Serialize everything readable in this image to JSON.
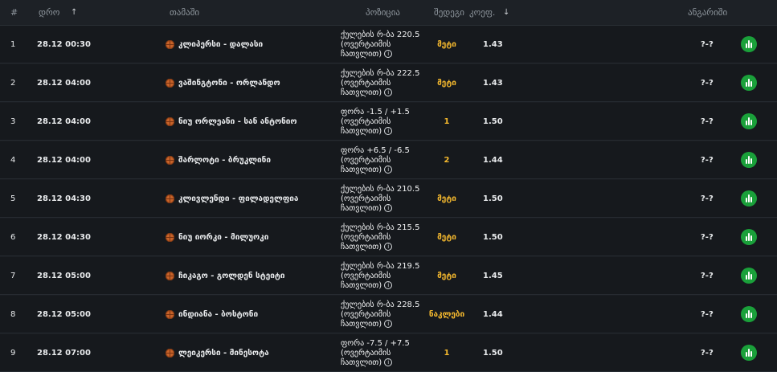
{
  "header": {
    "num": "#",
    "date": "დრო",
    "game": "თამაში",
    "position": "პოზიცია",
    "pick": "შედეგი",
    "coef": "კოეფ.",
    "result": "ანგარიში"
  },
  "rows": [
    {
      "num": "1",
      "date": "28.12  00:30",
      "game": "კლიპერსი - დალასი",
      "position": "ქულების რ-ბა 220.5 (ოვერტაიმის ჩათვლით)",
      "pick": "მეტი",
      "coef": "1.43",
      "result": "?-?"
    },
    {
      "num": "2",
      "date": "28.12  04:00",
      "game": "ვაშინგტონი - ორლანდო",
      "position": "ქულების რ-ბა 222.5 (ოვერტაიმის ჩათვლით)",
      "pick": "მეტი",
      "coef": "1.43",
      "result": "?-?"
    },
    {
      "num": "3",
      "date": "28.12  04:00",
      "game": "ნიუ ორლეანი - სან ანტონიო",
      "position": "ფორა -1.5 / +1.5 (ოვერტაიმის ჩათვლით)",
      "pick": "1",
      "coef": "1.50",
      "result": "?-?"
    },
    {
      "num": "4",
      "date": "28.12  04:00",
      "game": "შარლოტი - ბრუკლინი",
      "position": "ფორა +6.5 / -6.5 (ოვერტაიმის ჩათვლით)",
      "pick": "2",
      "coef": "1.44",
      "result": "?-?"
    },
    {
      "num": "5",
      "date": "28.12  04:30",
      "game": "კლივლენდი - ფილადელფია",
      "position": "ქულების რ-ბა 210.5 (ოვერტაიმის ჩათვლით)",
      "pick": "მეტი",
      "coef": "1.50",
      "result": "?-?"
    },
    {
      "num": "6",
      "date": "28.12  04:30",
      "game": "ნიუ იორკი - მილუოკი",
      "position": "ქულების რ-ბა 215.5 (ოვერტაიმის ჩათვლით)",
      "pick": "მეტი",
      "coef": "1.50",
      "result": "?-?"
    },
    {
      "num": "7",
      "date": "28.12  05:00",
      "game": "ჩიკაგო - გოლდენ სტეიტი",
      "position": "ქულების რ-ბა 219.5 (ოვერტაიმის ჩათვლით)",
      "pick": "მეტი",
      "coef": "1.45",
      "result": "?-?"
    },
    {
      "num": "8",
      "date": "28.12  05:00",
      "game": "ინდიანა - ბოსტონი",
      "position": "ქულების რ-ბა 228.5 (ოვერტაიმის ჩათვლით)",
      "pick": "ნაკლები",
      "coef": "1.44",
      "result": "?-?"
    },
    {
      "num": "9",
      "date": "28.12  07:00",
      "game": "ლეიკერსი - მინესოტა",
      "position": "ფორა -7.5 / +7.5 (ოვერტაიმის ჩათვლით)",
      "pick": "1",
      "coef": "1.50",
      "result": "?-?"
    }
  ],
  "icons": {
    "sport": "basketball-icon",
    "info": "info-icon",
    "live": "live-stats-icon",
    "sort_asc": "arrow-up-icon",
    "sort_desc": "arrow-down-icon"
  },
  "colors": {
    "pick": "#f5b92e",
    "live": "#1aa03a"
  }
}
